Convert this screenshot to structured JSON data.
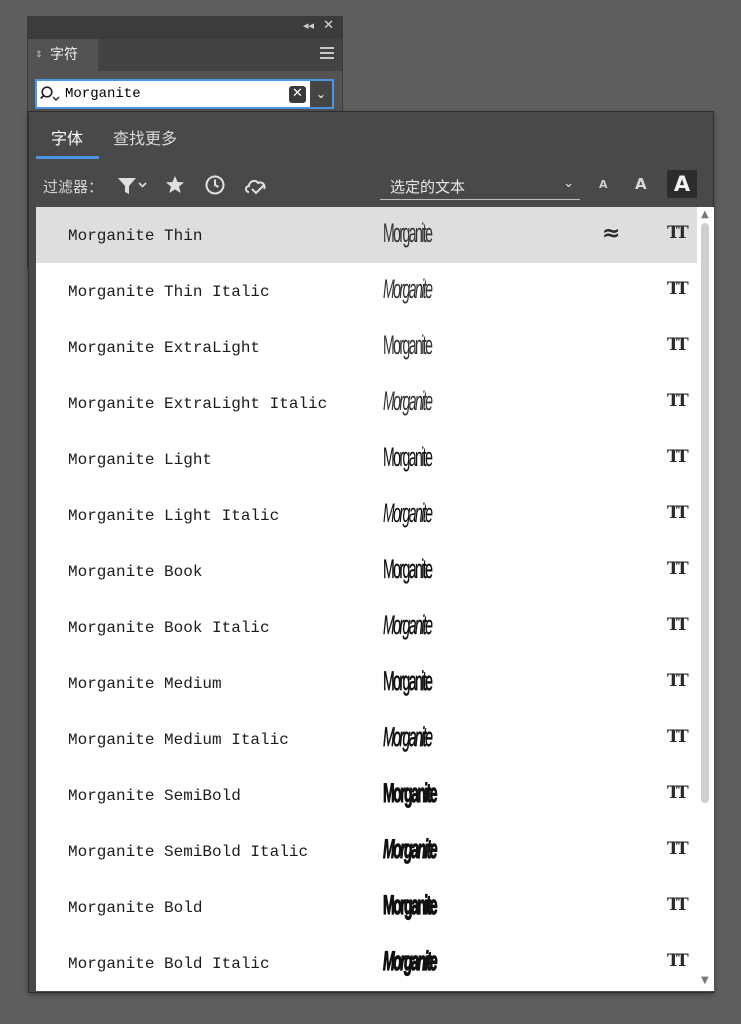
{
  "panel": {
    "title": "字符",
    "collapse_glyph": "◂◂",
    "close_glyph": "✕",
    "tab_arrows": "⇕"
  },
  "search": {
    "value": "Morganite",
    "clear_glyph": "✕",
    "dropdown_glyph": "⌄"
  },
  "popup": {
    "tabs": [
      {
        "label": "字体"
      },
      {
        "label": "查找更多"
      }
    ],
    "filter_label": "过滤器：",
    "preview_option": "选定的文本",
    "preview_chevron": "⌄",
    "size_small": "A",
    "size_medium": "A",
    "size_large": "A"
  },
  "fonts": [
    {
      "name": "Morganite Thin",
      "sample": "Morganite",
      "style": "normal",
      "weight": 100,
      "similar": "≈"
    },
    {
      "name": "Morganite Thin Italic",
      "sample": "Morganite",
      "style": "italic",
      "weight": 100,
      "similar": ""
    },
    {
      "name": "Morganite ExtraLight",
      "sample": "Morganite",
      "style": "normal",
      "weight": 200,
      "similar": ""
    },
    {
      "name": "Morganite ExtraLight Italic",
      "sample": "Morganite",
      "style": "italic",
      "weight": 200,
      "similar": ""
    },
    {
      "name": "Morganite Light",
      "sample": "Morganite",
      "style": "normal",
      "weight": 300,
      "similar": ""
    },
    {
      "name": "Morganite Light Italic",
      "sample": "Morganite",
      "style": "italic",
      "weight": 300,
      "similar": ""
    },
    {
      "name": "Morganite Book",
      "sample": "Morganite",
      "style": "normal",
      "weight": 400,
      "similar": ""
    },
    {
      "name": "Morganite Book Italic",
      "sample": "Morganite",
      "style": "italic",
      "weight": 400,
      "similar": ""
    },
    {
      "name": "Morganite Medium",
      "sample": "Morganite",
      "style": "normal",
      "weight": 500,
      "similar": ""
    },
    {
      "name": "Morganite Medium Italic",
      "sample": "Morganite",
      "style": "italic",
      "weight": 500,
      "similar": ""
    },
    {
      "name": "Morganite SemiBold",
      "sample": "Morganite",
      "style": "normal",
      "weight": 600,
      "similar": ""
    },
    {
      "name": "Morganite SemiBold Italic",
      "sample": "Morganite",
      "style": "italic",
      "weight": 600,
      "similar": ""
    },
    {
      "name": "Morganite Bold",
      "sample": "Morganite",
      "style": "normal",
      "weight": 700,
      "similar": ""
    },
    {
      "name": "Morganite Bold Italic",
      "sample": "Morganite",
      "style": "italic",
      "weight": 700,
      "similar": ""
    }
  ],
  "type_icon_glyph": "TT",
  "scroll": {
    "up": "▲",
    "down": "▼"
  },
  "colors": {
    "accent": "#4b97e6",
    "selected_row": "#dedede",
    "panel_bg": "#494949"
  }
}
